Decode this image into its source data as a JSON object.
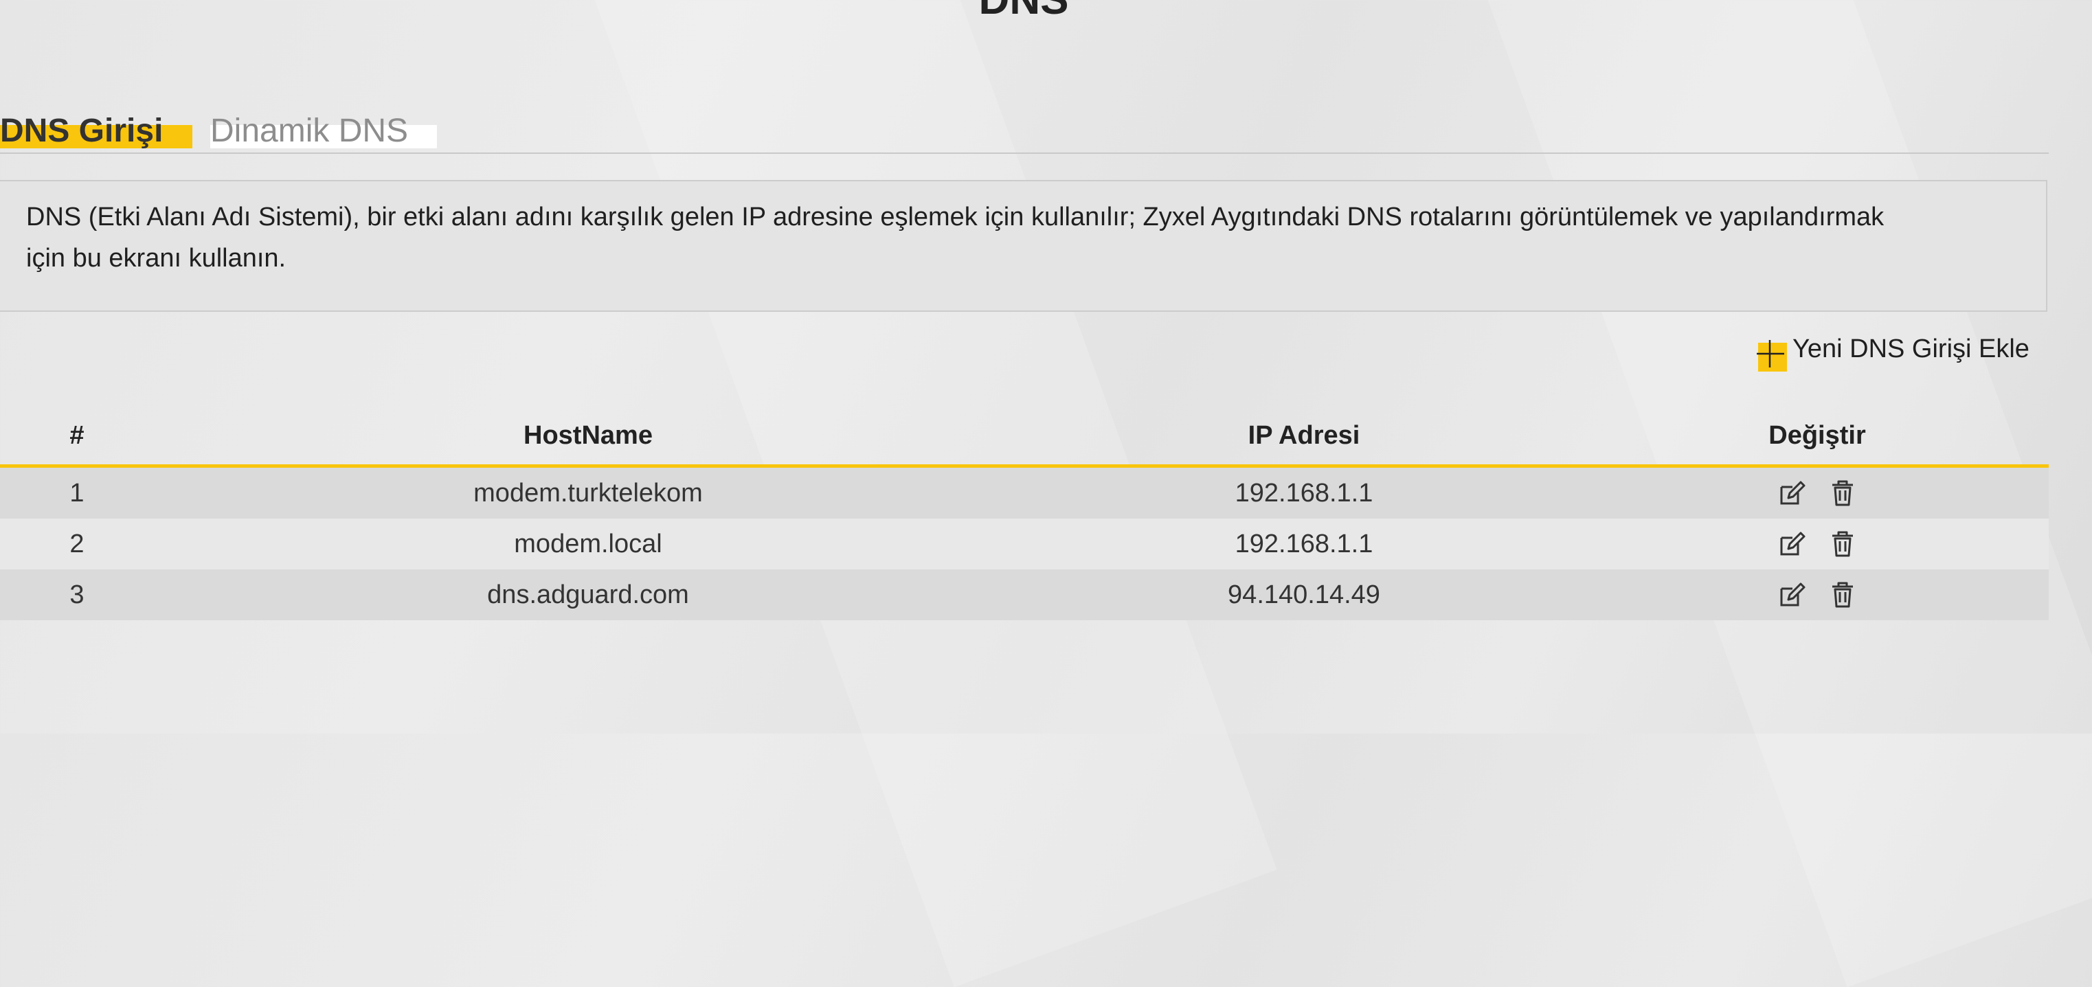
{
  "page": {
    "title": "DNS"
  },
  "tabs": [
    {
      "label": "DNS Girişi",
      "active": true
    },
    {
      "label": "Dinamik DNS",
      "active": false
    }
  ],
  "info": {
    "text_line1": "DNS (Etki Alanı Adı Sistemi), bir etki alanı adını karşılık gelen IP adresine eşlemek için kullanılır; Zyxel Aygıtındaki DNS rotalarını görüntülemek ve yapılandırmak",
    "text_line2": "için bu ekranı kullanın."
  },
  "add_entry": {
    "label": "Yeni DNS Girişi Ekle",
    "icon": "plus-icon"
  },
  "table": {
    "headers": {
      "num": "#",
      "hostname": "HostName",
      "ip": "IP Adresi",
      "edit": "Değiştir"
    },
    "rows": [
      {
        "num": "1",
        "hostname": "modem.turktelekom",
        "ip": "192.168.1.1"
      },
      {
        "num": "2",
        "hostname": "modem.local",
        "ip": "192.168.1.1"
      },
      {
        "num": "3",
        "hostname": "dns.adguard.com",
        "ip": "94.140.14.49"
      }
    ],
    "row_actions": [
      "edit-icon",
      "trash-icon"
    ]
  },
  "colors": {
    "accent": "#f9c50d",
    "text": "#222222",
    "inactive_tab": "#8d8d8d"
  }
}
